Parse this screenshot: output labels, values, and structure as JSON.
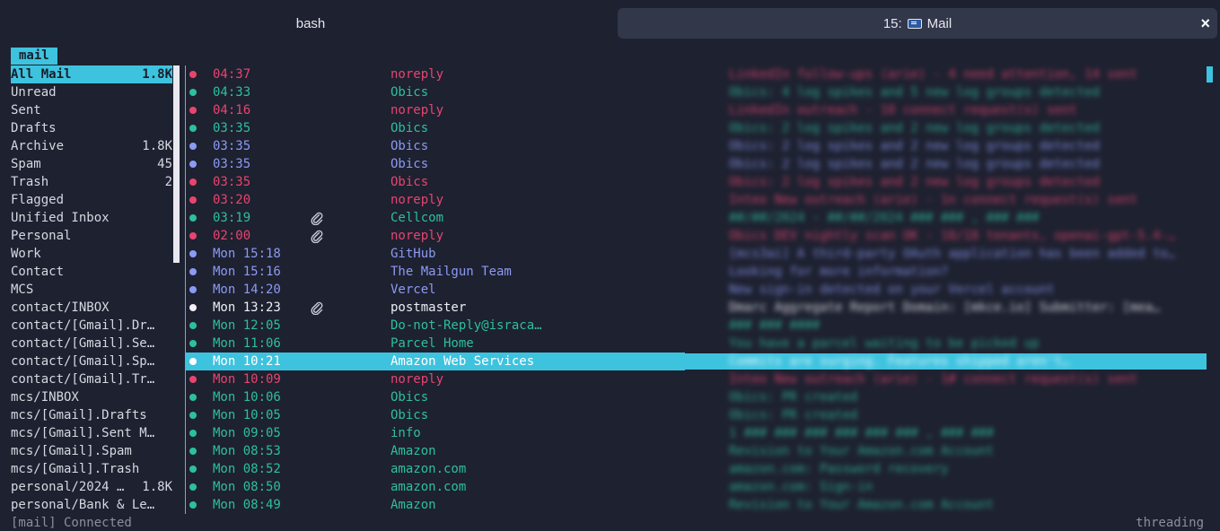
{
  "tabs": {
    "bash": "bash",
    "mail_prefix": "15:",
    "mail_title": "Mail",
    "close": "×"
  },
  "account_tag": "mail",
  "sidebar": [
    {
      "label": "All Mail",
      "count": "1.8K",
      "active": true
    },
    {
      "label": "Unread",
      "count": ""
    },
    {
      "label": "Sent",
      "count": ""
    },
    {
      "label": "Drafts",
      "count": ""
    },
    {
      "label": "Archive",
      "count": "1.8K"
    },
    {
      "label": "Spam",
      "count": "45"
    },
    {
      "label": "Trash",
      "count": "2"
    },
    {
      "label": "Flagged",
      "count": ""
    },
    {
      "label": "Unified Inbox",
      "count": ""
    },
    {
      "label": "Personal",
      "count": ""
    },
    {
      "label": "Work",
      "count": ""
    },
    {
      "label": "Contact",
      "count": ""
    },
    {
      "label": "MCS",
      "count": ""
    },
    {
      "label": "contact/INBOX",
      "count": ""
    },
    {
      "label": "contact/[Gmail].Dr…",
      "count": ""
    },
    {
      "label": "contact/[Gmail].Se…",
      "count": ""
    },
    {
      "label": "contact/[Gmail].Sp…",
      "count": ""
    },
    {
      "label": "contact/[Gmail].Tr…",
      "count": ""
    },
    {
      "label": "mcs/INBOX",
      "count": ""
    },
    {
      "label": "mcs/[Gmail].Drafts",
      "count": ""
    },
    {
      "label": "mcs/[Gmail].Sent M…",
      "count": ""
    },
    {
      "label": "mcs/[Gmail].Spam",
      "count": ""
    },
    {
      "label": "mcs/[Gmail].Trash",
      "count": ""
    },
    {
      "label": "personal/2024 …",
      "count": "1.8K"
    },
    {
      "label": "personal/Bank & Le…",
      "count": ""
    }
  ],
  "messages": [
    {
      "time": "04:37",
      "from": "noreply",
      "color": "red",
      "attach": false,
      "subject": "LinkedIn follow-ups (arie) - 4 need attention, 14 sent"
    },
    {
      "time": "04:33",
      "from": "Obics",
      "color": "teal",
      "attach": false,
      "subject": "Obics: 4 log spikes and 5 new log groups detected"
    },
    {
      "time": "04:16",
      "from": "noreply",
      "color": "red",
      "attach": false,
      "subject": "LinkedIn outreach - 10 connect request(s) sent"
    },
    {
      "time": "03:35",
      "from": "Obics",
      "color": "teal",
      "attach": false,
      "subject": "Obics: 2 log spikes and 2 new log groups detected"
    },
    {
      "time": "03:35",
      "from": "Obics",
      "color": "blue",
      "attach": false,
      "subject": "Obics: 2 log spikes and 2 new log groups detected"
    },
    {
      "time": "03:35",
      "from": "Obics",
      "color": "blue",
      "attach": false,
      "subject": "Obics: 2 log spikes and 2 new log groups detected"
    },
    {
      "time": "03:35",
      "from": "Obics",
      "color": "red",
      "attach": false,
      "subject": "Obics: 2 log spikes and 2 new log groups detected"
    },
    {
      "time": "03:20",
      "from": "noreply",
      "color": "red",
      "attach": false,
      "subject": "Inteo New outreach (arie) - 1n connect request(s) sent"
    },
    {
      "time": "03:19",
      "from": "Cellcom",
      "color": "teal",
      "attach": true,
      "subject": "##/##/2024 - ##/##/2024 ### ### , ### ###"
    },
    {
      "time": "02:00",
      "from": "noreply",
      "color": "red",
      "attach": true,
      "subject": "Obics DEV nightly scan OK - 18/18 tenants, openai-gpt-5.4-…"
    },
    {
      "time": "Mon 15:18",
      "from": "GitHub",
      "color": "blue",
      "attach": false,
      "subject": "[mcs3ai] A third-party OAuth application has been added to…"
    },
    {
      "time": "Mon 15:16",
      "from": "The Mailgun Team",
      "color": "blue",
      "attach": false,
      "subject": "Looking for more information?"
    },
    {
      "time": "Mon 14:20",
      "from": "Vercel",
      "color": "blue",
      "attach": false,
      "subject": "New sign-in detected on your Vercel account"
    },
    {
      "time": "Mon 13:23",
      "from": "postmaster",
      "color": "white",
      "attach": true,
      "subject": "Dmarc Aggregate Report Domain: [mkce.io] Submitter: [mea…"
    },
    {
      "time": "Mon 12:05",
      "from": "Do-not-Reply@israca…",
      "color": "teal",
      "attach": false,
      "subject": "### ### ####"
    },
    {
      "time": "Mon 11:06",
      "from": "Parcel Home",
      "color": "teal",
      "attach": false,
      "subject": "You have a parcel waiting to be picked up"
    },
    {
      "time": "Mon 10:21",
      "from": "Amazon Web Services",
      "color": "white",
      "attach": false,
      "selected": true,
      "subject": "Commits are surging. Features shipped aren't…"
    },
    {
      "time": "Mon 10:09",
      "from": "noreply",
      "color": "red",
      "attach": false,
      "subject": "Inteo New outreach (arie) - 1# connect request(s) sent"
    },
    {
      "time": "Mon 10:06",
      "from": "Obics",
      "color": "teal",
      "attach": false,
      "subject": "Obics: PR created"
    },
    {
      "time": "Mon 10:05",
      "from": "Obics",
      "color": "teal",
      "attach": false,
      "subject": "Obics: PR created"
    },
    {
      "time": "Mon 09:05",
      "from": "info",
      "color": "teal",
      "attach": false,
      "subject": "1 ### ### ### ### ### ### , ### ###"
    },
    {
      "time": "Mon 08:53",
      "from": "Amazon",
      "color": "teal",
      "attach": false,
      "subject": "Revision to Your Amazon.com Account"
    },
    {
      "time": "Mon 08:52",
      "from": "amazon.com",
      "color": "teal",
      "attach": false,
      "subject": "amazon.com: Password recovery"
    },
    {
      "time": "Mon 08:50",
      "from": "amazon.com",
      "color": "teal",
      "attach": false,
      "subject": "amazon.com: Sign-in"
    },
    {
      "time": "Mon 08:49",
      "from": "Amazon",
      "color": "teal",
      "attach": false,
      "subject": "Revision to Your Amazon.com Account"
    }
  ],
  "status": {
    "left": "[mail] Connected",
    "right": "threading"
  },
  "colors": {
    "accent": "#3ec3df",
    "red": "#e7456f",
    "teal": "#2dbf9f",
    "blue": "#8b9af4",
    "background": "#1e2130"
  }
}
